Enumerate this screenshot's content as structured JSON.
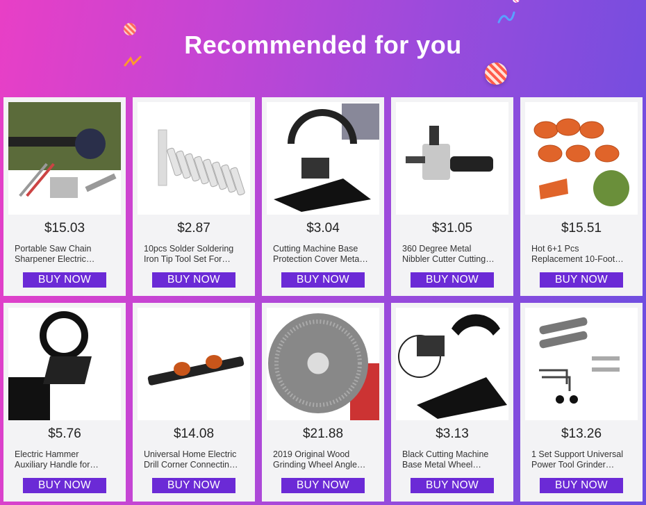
{
  "header": {
    "title": "Recommended for you"
  },
  "buy_label": "BUY NOW",
  "products": [
    {
      "price": "$15.03",
      "name1": "Portable Saw Chain",
      "name2": "Sharpener Electric…",
      "icon": "chainsaw-sharpener-icon"
    },
    {
      "price": "$2.87",
      "name1": "10pcs Solder Soldering",
      "name2": "Iron Tip Tool Set For…",
      "icon": "solder-tips-icon"
    },
    {
      "price": "$3.04",
      "name1": "Cutting Machine Base",
      "name2": "Protection Cover Meta…",
      "icon": "cutting-base-icon"
    },
    {
      "price": "$31.05",
      "name1": "360 Degree Metal",
      "name2": "Nibbler Cutter Cutting…",
      "icon": "nibbler-cutter-icon"
    },
    {
      "price": "$15.51",
      "name1": "Hot 6+1 Pcs",
      "name2": "Replacement 10-Foot…",
      "icon": "trimmer-spools-icon"
    },
    {
      "price": "$5.76",
      "name1": "Electric Hammer",
      "name2": "Auxiliary Handle for…",
      "icon": "auxiliary-handle-icon"
    },
    {
      "price": "$14.08",
      "name1": "Universal Home Electric",
      "name2": "Drill Corner Connectin…",
      "icon": "drill-connector-icon"
    },
    {
      "price": "$21.88",
      "name1": "2019 Original Wood",
      "name2": "Grinding Wheel Angle…",
      "icon": "grinding-wheel-icon"
    },
    {
      "price": "$3.13",
      "name1": "Black Cutting Machine",
      "name2": "Base Metal Wheel…",
      "icon": "grinder-base-icon"
    },
    {
      "price": "$13.26",
      "name1": "1 Set Support Universal",
      "name2": "Power Tool Grinder…",
      "icon": "grinder-parts-icon"
    }
  ],
  "colors": {
    "button": "#6b2ad6",
    "card": "#f3f3f5"
  }
}
